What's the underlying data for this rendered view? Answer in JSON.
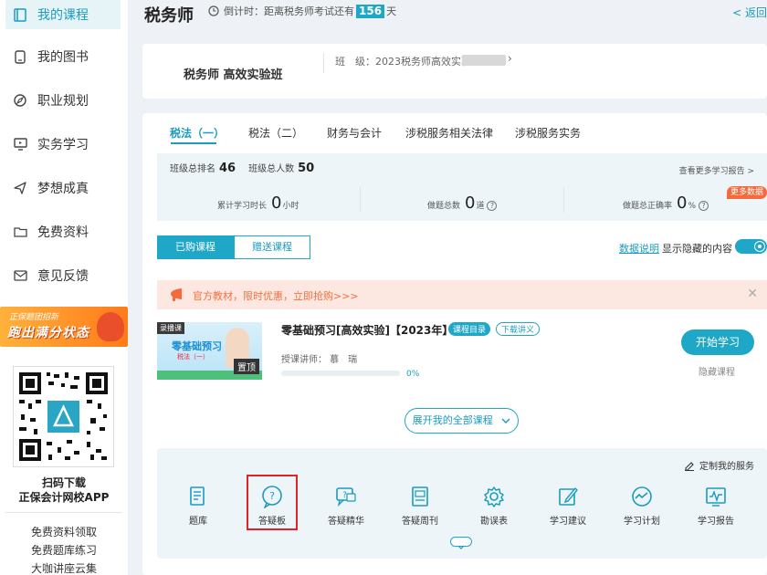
{
  "sidebar": {
    "items": [
      {
        "label": "我的课程",
        "icon": "book-icon",
        "active": true
      },
      {
        "label": "我的图书",
        "icon": "phone-book-icon",
        "active": false
      },
      {
        "label": "职业规划",
        "icon": "compass-icon",
        "active": false
      },
      {
        "label": "实务学习",
        "icon": "monitor-icon",
        "active": false
      },
      {
        "label": "梦想成真",
        "icon": "paper-plane-icon",
        "active": false
      },
      {
        "label": "免费资料",
        "icon": "folder-icon",
        "active": false
      },
      {
        "label": "意见反馈",
        "icon": "mail-icon",
        "active": false
      }
    ],
    "promo": {
      "line1": "正保题团招新",
      "line2": "跑出满分状态"
    },
    "qr_caption_1": "扫码下载",
    "qr_caption_2": "正保会计网校APP",
    "links": [
      "免费资料领取",
      "免费题库练习",
      "大咖讲座云集"
    ]
  },
  "header": {
    "title": "税务师",
    "countdown_prefix": "倒计时：距离税务师考试还有",
    "countdown_days": "156",
    "countdown_suffix": "天",
    "back_label": "< 返回"
  },
  "class_info": {
    "name": "税务师 高效实验班",
    "label": "班　级：2023税务师高效实验"
  },
  "tabs": [
    {
      "label": "税法（一）",
      "active": true
    },
    {
      "label": "税法（二）",
      "active": false
    },
    {
      "label": "财务与会计",
      "active": false
    },
    {
      "label": "涉税服务相关法律",
      "active": false
    },
    {
      "label": "涉税服务实务",
      "active": false
    }
  ],
  "stats": {
    "rank_label": "班级总排名",
    "rank_value": "46",
    "total_label": "班级总人数",
    "total_value": "50",
    "report_link": "查看更多学习报告 >",
    "study_time_label": "累计学习时长",
    "study_time_value": "0",
    "study_time_unit": "小时",
    "questions_label": "做题总数",
    "questions_value": "0",
    "questions_unit": "道",
    "accuracy_label": "做题总正确率",
    "accuracy_value": "0",
    "accuracy_unit": "%",
    "more_data_badge": "更多数据"
  },
  "course_toggle": {
    "purchased": "已购课程",
    "gifted": "赠送课程",
    "data_note": "数据说明",
    "show_hidden": "显示隐藏的内容",
    "show_hidden_on": true
  },
  "notice": {
    "text": "官方教材，限时优惠，立即抢购>>>"
  },
  "course": {
    "thumb_tag": "录播课",
    "thumb_title": "零基础预习",
    "thumb_sub": "税法（一）",
    "pin_label": "置顶",
    "title": "零基础预习[高效实验]【2023年】",
    "catalog_label": "课程目录",
    "handout_label": "下载讲义",
    "teacher": "授课讲师：  慕　瑞",
    "progress": 0,
    "progress_text": "0%",
    "start_label": "开始学习",
    "hide_label": "隐藏课程"
  },
  "expand_label": "展开我的全部课程",
  "services": {
    "custom_label": "定制我的服务",
    "items": [
      {
        "label": "题库",
        "icon": "question-bank-icon"
      },
      {
        "label": "答疑板",
        "icon": "qa-board-icon"
      },
      {
        "label": "答疑精华",
        "icon": "qa-essence-icon"
      },
      {
        "label": "答疑周刊",
        "icon": "weekly-icon"
      },
      {
        "label": "勘误表",
        "icon": "gear-icon"
      },
      {
        "label": "学习建议",
        "icon": "edit-icon"
      },
      {
        "label": "学习计划",
        "icon": "pulse-icon"
      },
      {
        "label": "学习报告",
        "icon": "report-icon"
      }
    ]
  },
  "colors": {
    "accent": "#1ea7c6",
    "notice_text": "#f2703f",
    "badge": "#f56a3c",
    "highlight_box": "#e02424"
  }
}
